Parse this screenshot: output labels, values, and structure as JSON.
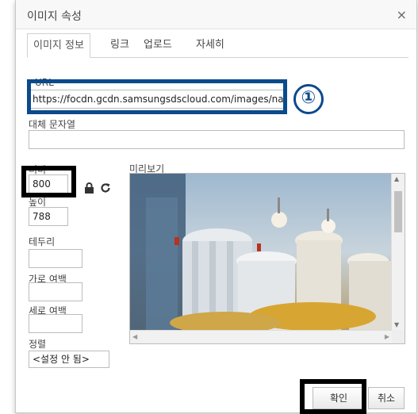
{
  "dialog": {
    "title": "이미지 속성",
    "close_glyph": "×"
  },
  "tabs": [
    {
      "label": "이미지 정보",
      "active": true
    },
    {
      "label": "링크"
    },
    {
      "label": "업로드"
    },
    {
      "label": "자세히"
    }
  ],
  "fields": {
    "url_label": "URL",
    "url_value": "https://focdn.gcdn.samsungsdscloud.com/images/na",
    "alt_label": "대체 문자열",
    "alt_value": "",
    "width_label": "너비",
    "width_value": "800",
    "height_label": "높이",
    "height_value": "788",
    "border_label": "테두리",
    "border_value": "",
    "hspace_label": "가로 여백",
    "hspace_value": "",
    "vspace_label": "세로 여백",
    "vspace_value": "",
    "align_label": "정렬",
    "align_value": "<설정 안 됨>"
  },
  "preview": {
    "label": "미리보기"
  },
  "annotation": {
    "marker": "①"
  },
  "buttons": {
    "ok": "확인",
    "cancel": "취소"
  },
  "icons": {
    "lock": "lock-icon",
    "reset": "reset-size-icon"
  },
  "colors": {
    "highlight_blue": "#0b4a8c",
    "highlight_black": "#000000"
  }
}
